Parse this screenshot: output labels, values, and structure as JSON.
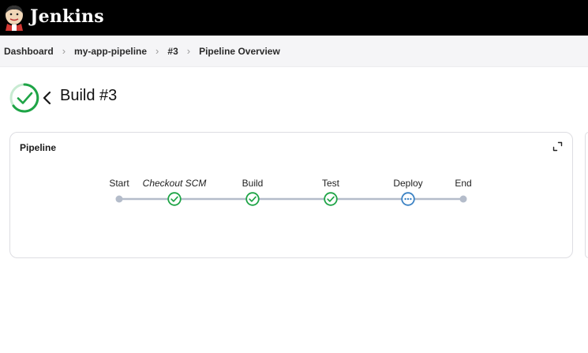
{
  "header": {
    "brand": "Jenkins",
    "logo_icon": "jenkins-butler-logo",
    "background": "#000000"
  },
  "breadcrumb": {
    "items": [
      "Dashboard",
      "my-app-pipeline",
      "#3",
      "Pipeline Overview"
    ],
    "separator_icon": "chevron-right-icon"
  },
  "build": {
    "title": "Build #3",
    "status": "success",
    "status_icon": "check-circle-icon",
    "back_icon": "chevron-left-icon"
  },
  "pipeline_card": {
    "title": "Pipeline",
    "expand_icon": "expand-icon"
  },
  "pipeline": {
    "stages": [
      {
        "label": "Start",
        "status": "start",
        "italic": false
      },
      {
        "label": "Checkout SCM",
        "status": "success",
        "italic": true
      },
      {
        "label": "Build",
        "status": "success",
        "italic": false
      },
      {
        "label": "Test",
        "status": "success",
        "italic": false
      },
      {
        "label": "Deploy",
        "status": "running",
        "italic": false
      },
      {
        "label": "End",
        "status": "end",
        "italic": false
      }
    ]
  },
  "colors": {
    "success": "#1ea446",
    "running": "#3b82c4",
    "connector": "#b4bcca",
    "card_border": "#dddde2"
  }
}
